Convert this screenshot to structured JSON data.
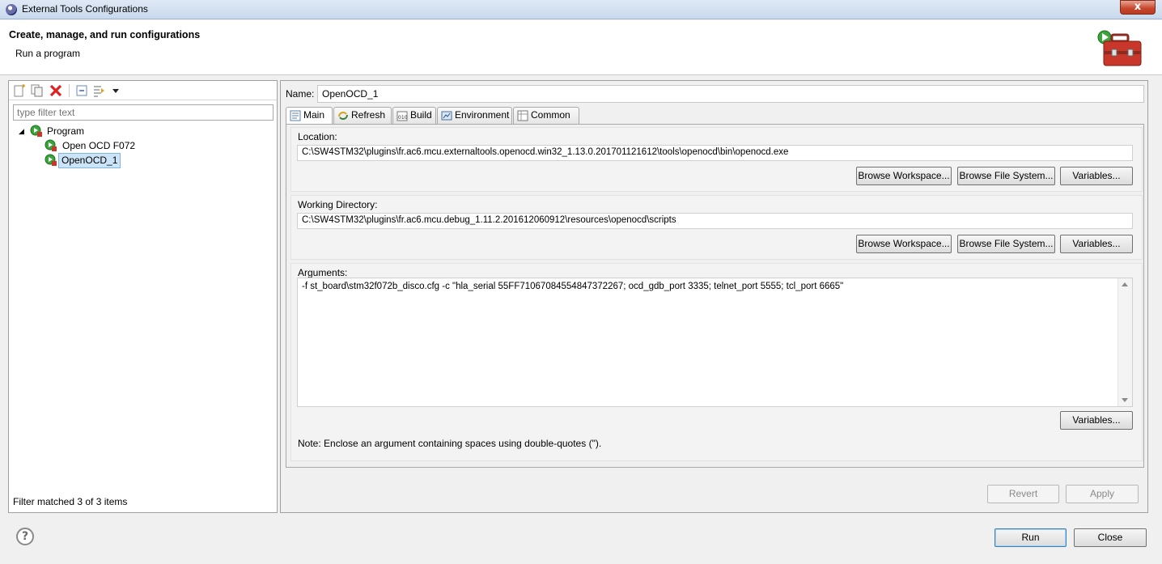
{
  "window": {
    "title": "External Tools Configurations",
    "close_glyph": "x"
  },
  "header": {
    "title": "Create, manage, and run configurations",
    "subtitle": "Run a program",
    "icon": "external-tools-toolbox-icon"
  },
  "left": {
    "toolbar_icons": [
      "new-configuration-icon",
      "duplicate-icon",
      "delete-icon",
      "collapse-all-icon",
      "filter-icon",
      "dropdown-arrow-icon"
    ],
    "filter_placeholder": "type filter text",
    "tree": [
      {
        "label": "Program",
        "level": 0,
        "expanded": true,
        "selected": false
      },
      {
        "label": "Open OCD F072",
        "level": 1,
        "selected": false
      },
      {
        "label": "OpenOCD_1",
        "level": 1,
        "selected": true
      }
    ],
    "status": "Filter matched 3 of 3 items"
  },
  "right": {
    "name_label": "Name:",
    "name_value": "OpenOCD_1",
    "tabs": [
      {
        "label": "Main",
        "icon": "main-tab-icon",
        "active": true
      },
      {
        "label": "Refresh",
        "icon": "refresh-icon",
        "active": false
      },
      {
        "label": "Build",
        "icon": "build-icon",
        "active": false
      },
      {
        "label": "Environment",
        "icon": "environment-icon",
        "active": false
      },
      {
        "label": "Common",
        "icon": "common-icon",
        "active": false
      }
    ],
    "location": {
      "label": "Location:",
      "value": "C:\\SW4STM32\\plugins\\fr.ac6.mcu.externaltools.openocd.win32_1.13.0.201701121612\\tools\\openocd\\bin\\openocd.exe",
      "buttons": [
        "Browse Workspace...",
        "Browse File System...",
        "Variables..."
      ]
    },
    "working_dir": {
      "label": "Working Directory:",
      "value": "C:\\SW4STM32\\plugins\\fr.ac6.mcu.debug_1.11.2.201612060912\\resources\\openocd\\scripts",
      "buttons": [
        "Browse Workspace...",
        "Browse File System...",
        "Variables..."
      ]
    },
    "arguments": {
      "label": "Arguments:",
      "value": "-f st_board\\stm32f072b_disco.cfg -c \"hla_serial 55FF71067084554847372267; ocd_gdb_port 3335; telnet_port 5555; tcl_port 6665\"",
      "variables_button": "Variables...",
      "note": "Note: Enclose an argument containing spaces using double-quotes (\")."
    },
    "revert": "Revert",
    "apply": "Apply"
  },
  "footer": {
    "help": "?",
    "run": "Run",
    "close": "Close"
  }
}
